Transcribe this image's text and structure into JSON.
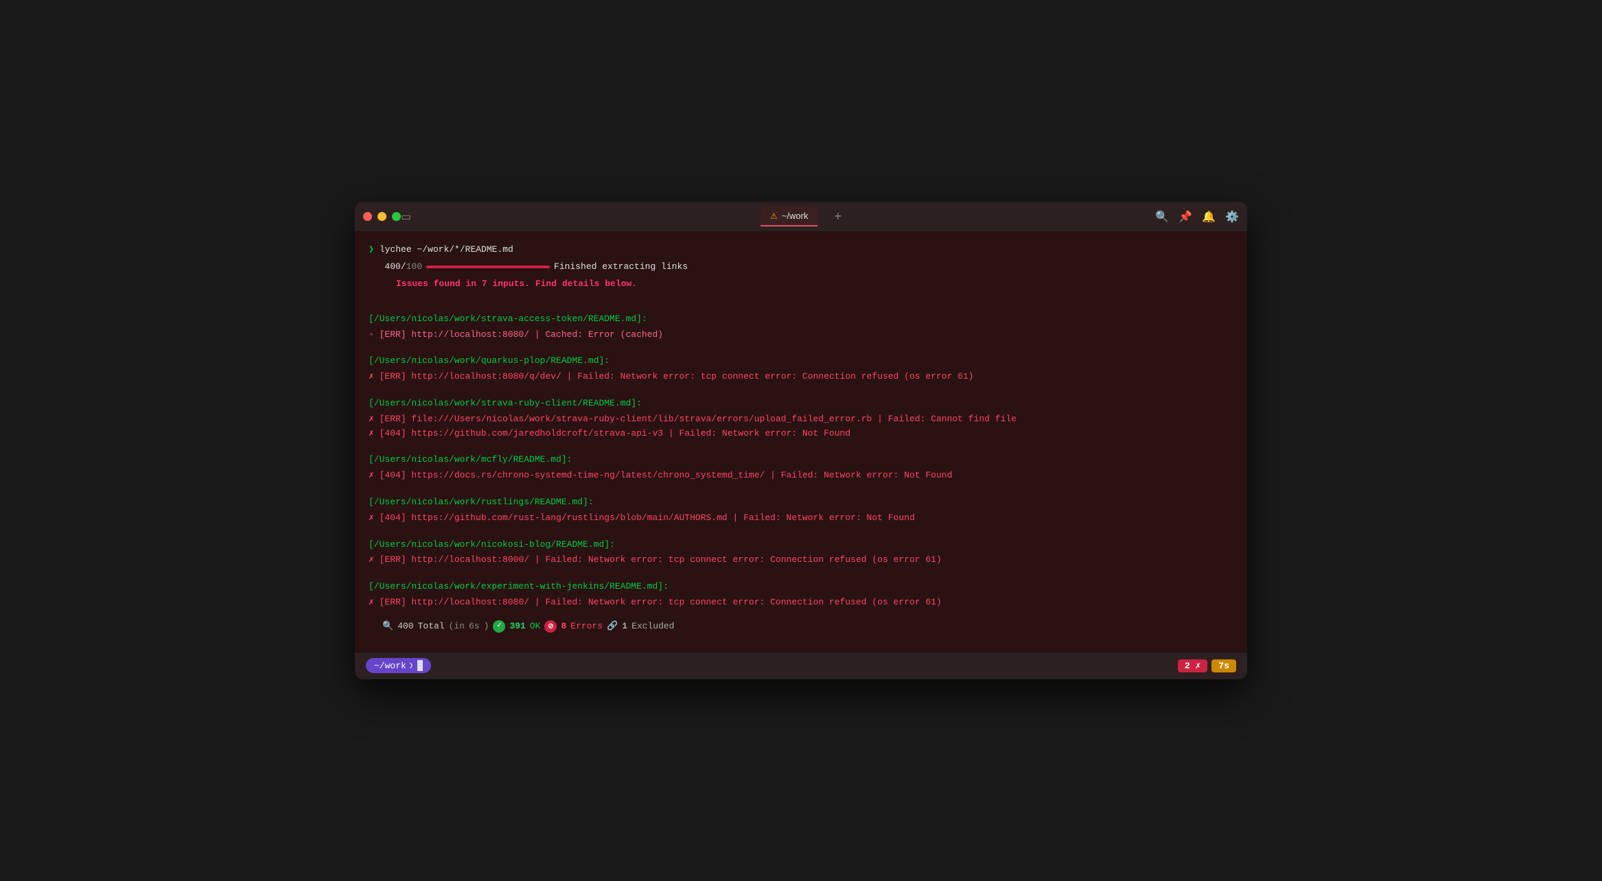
{
  "window": {
    "title": "~/work"
  },
  "titlebar": {
    "tab_icon": "⚠",
    "tab_title": "~/work",
    "add_tab": "+",
    "icons": [
      "search",
      "pin",
      "bell",
      "settings"
    ]
  },
  "terminal": {
    "prompt_cmd": "lychee ~/work/*/README.md",
    "progress_prefix": "400/",
    "progress_suffix": "100",
    "progress_msg": "Finished extracting links",
    "issues_msg": "Issues found in 7 inputs. Find details below.",
    "entries": [
      {
        "file": "[/Users/nicolas/work/strava-access-token/README.md]:",
        "errors": [
          {
            "type": "cached",
            "text": "◦ [ERR] http://localhost:8080/ | Cached: Error (cached)"
          }
        ]
      },
      {
        "file": "[/Users/nicolas/work/quarkus-plop/README.md]:",
        "errors": [
          {
            "type": "err",
            "text": "✗ [ERR] http://localhost:8080/q/dev/ | Failed: Network error: tcp connect error: Connection refused (os error 61)"
          }
        ]
      },
      {
        "file": "[/Users/nicolas/work/strava-ruby-client/README.md]:",
        "errors": [
          {
            "type": "err",
            "text": "✗ [ERR] file:///Users/nicolas/work/strava-ruby-client/lib/strava/errors/upload_failed_error.rb | Failed: Cannot find file"
          },
          {
            "type": "err",
            "text": "✗ [404] https://github.com/jaredholdcroft/strava-api-v3 | Failed: Network error: Not Found"
          }
        ]
      },
      {
        "file": "[/Users/nicolas/work/mcfly/README.md]:",
        "errors": [
          {
            "type": "err",
            "text": "✗ [404] https://docs.rs/chrono-systemd-time-ng/latest/chrono_systemd_time/ | Failed: Network error: Not Found"
          }
        ]
      },
      {
        "file": "[/Users/nicolas/work/rustlings/README.md]:",
        "errors": [
          {
            "type": "err",
            "text": "✗ [404] https://github.com/rust-lang/rustlings/blob/main/AUTHORS.md | Failed: Network error: Not Found"
          }
        ]
      },
      {
        "file": "[/Users/nicolas/work/nicokosi-blog/README.md]:",
        "errors": [
          {
            "type": "err",
            "text": "✗ [ERR] http://localhost:8000/ | Failed: Network error: tcp connect error: Connection refused (os error 61)"
          }
        ]
      },
      {
        "file": "[/Users/nicolas/work/experiment-with-jenkins/README.md]:",
        "errors": [
          {
            "type": "err",
            "text": "✗ [ERR] http://localhost:8080/ | Failed: Network error: tcp connect error: Connection refused (os error 61)"
          }
        ]
      }
    ],
    "status": {
      "total": "400",
      "time": "6s",
      "ok_count": "391",
      "err_count": "8",
      "excl_count": "1"
    }
  },
  "bottombar": {
    "cwd": "~/work",
    "err_count": "2 ✗",
    "time": "7s"
  }
}
